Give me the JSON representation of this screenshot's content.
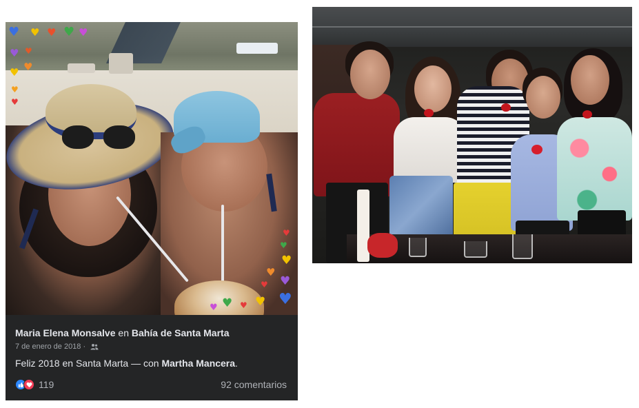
{
  "post": {
    "author": "Maria Elena Monsalve",
    "connector": "en",
    "place": "Bahía de Santa Marta",
    "date": "7 de enero de 2018",
    "audience_icon": "friends-icon",
    "caption_text": "Feliz 2018 en Santa Marta — con",
    "tagged": "Martha Mancera",
    "caption_end": ".",
    "reactions": {
      "icons": [
        "like-icon",
        "love-icon"
      ],
      "count": "119"
    },
    "comments": "92 comentarios"
  },
  "photos": {
    "left": "beach-selfie-photo",
    "right": "party-group-photo"
  },
  "colors": {
    "card_bg": "#242526",
    "text_primary": "#e4e6eb",
    "text_secondary": "#b0b3b8",
    "like_blue": "#2d88ff",
    "love_red": "#f33e58"
  }
}
